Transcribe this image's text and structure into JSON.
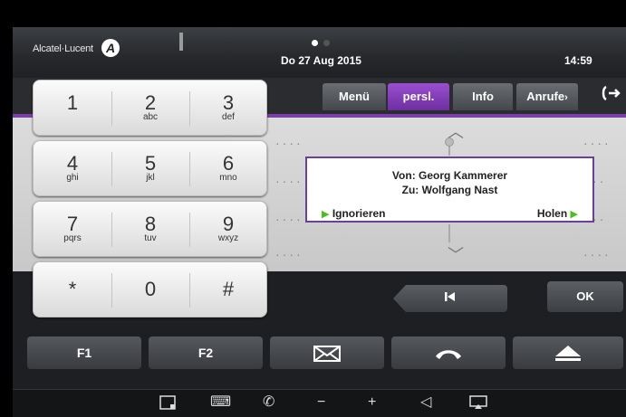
{
  "header": {
    "brand": "Alcatel·Lucent",
    "brand_logo": "A",
    "date": "Do 27 Aug 2015",
    "time": "14:59",
    "page_indicator": {
      "pages": 2,
      "current": 1
    }
  },
  "tabs": [
    {
      "label": "Menü",
      "active": false
    },
    {
      "label": "persl.",
      "active": true
    },
    {
      "label": "Info",
      "active": false
    },
    {
      "label": "Anrufe",
      "active": false
    }
  ],
  "tab_more_glyph": "›",
  "exit_icon": "exit-arrow-icon",
  "keypad": [
    [
      {
        "num": "1",
        "sub": ""
      },
      {
        "num": "2",
        "sub": "abc"
      },
      {
        "num": "3",
        "sub": "def"
      }
    ],
    [
      {
        "num": "4",
        "sub": "ghi"
      },
      {
        "num": "5",
        "sub": "jkl"
      },
      {
        "num": "6",
        "sub": "mno"
      }
    ],
    [
      {
        "num": "7",
        "sub": "pqrs"
      },
      {
        "num": "8",
        "sub": "tuv"
      },
      {
        "num": "9",
        "sub": "wxyz"
      }
    ],
    [
      {
        "num": "*",
        "sub": ""
      },
      {
        "num": "0",
        "sub": ""
      },
      {
        "num": "#",
        "sub": ""
      }
    ]
  ],
  "popup": {
    "from": "Von: Georg Kammerer",
    "to": "Zu: Wolfgang Nast",
    "ignore_label": "Ignorieren",
    "accept_label": "Holen"
  },
  "nav": {
    "back_glyph": "◀",
    "ok_label": "OK"
  },
  "function_keys": [
    {
      "label": "F1",
      "icon": ""
    },
    {
      "label": "F2",
      "icon": ""
    },
    {
      "label": "",
      "icon": "envelope-icon"
    },
    {
      "label": "",
      "icon": "hangup-icon"
    },
    {
      "label": "",
      "icon": "eject-icon"
    }
  ],
  "iconbar": [
    {
      "icon": "window-icon",
      "glyph": "▭"
    },
    {
      "icon": "keyboard-icon",
      "glyph": "⌨"
    },
    {
      "icon": "handset-icon",
      "glyph": "✆"
    },
    {
      "icon": "volume-down-icon",
      "glyph": "−"
    },
    {
      "icon": "volume-up-icon",
      "glyph": "+"
    },
    {
      "icon": "speaker-icon",
      "glyph": "◁"
    },
    {
      "icon": "display-icon",
      "glyph": "▭"
    }
  ],
  "colors": {
    "accent_purple": "#7b3fa8",
    "action_green": "#44c21f"
  }
}
